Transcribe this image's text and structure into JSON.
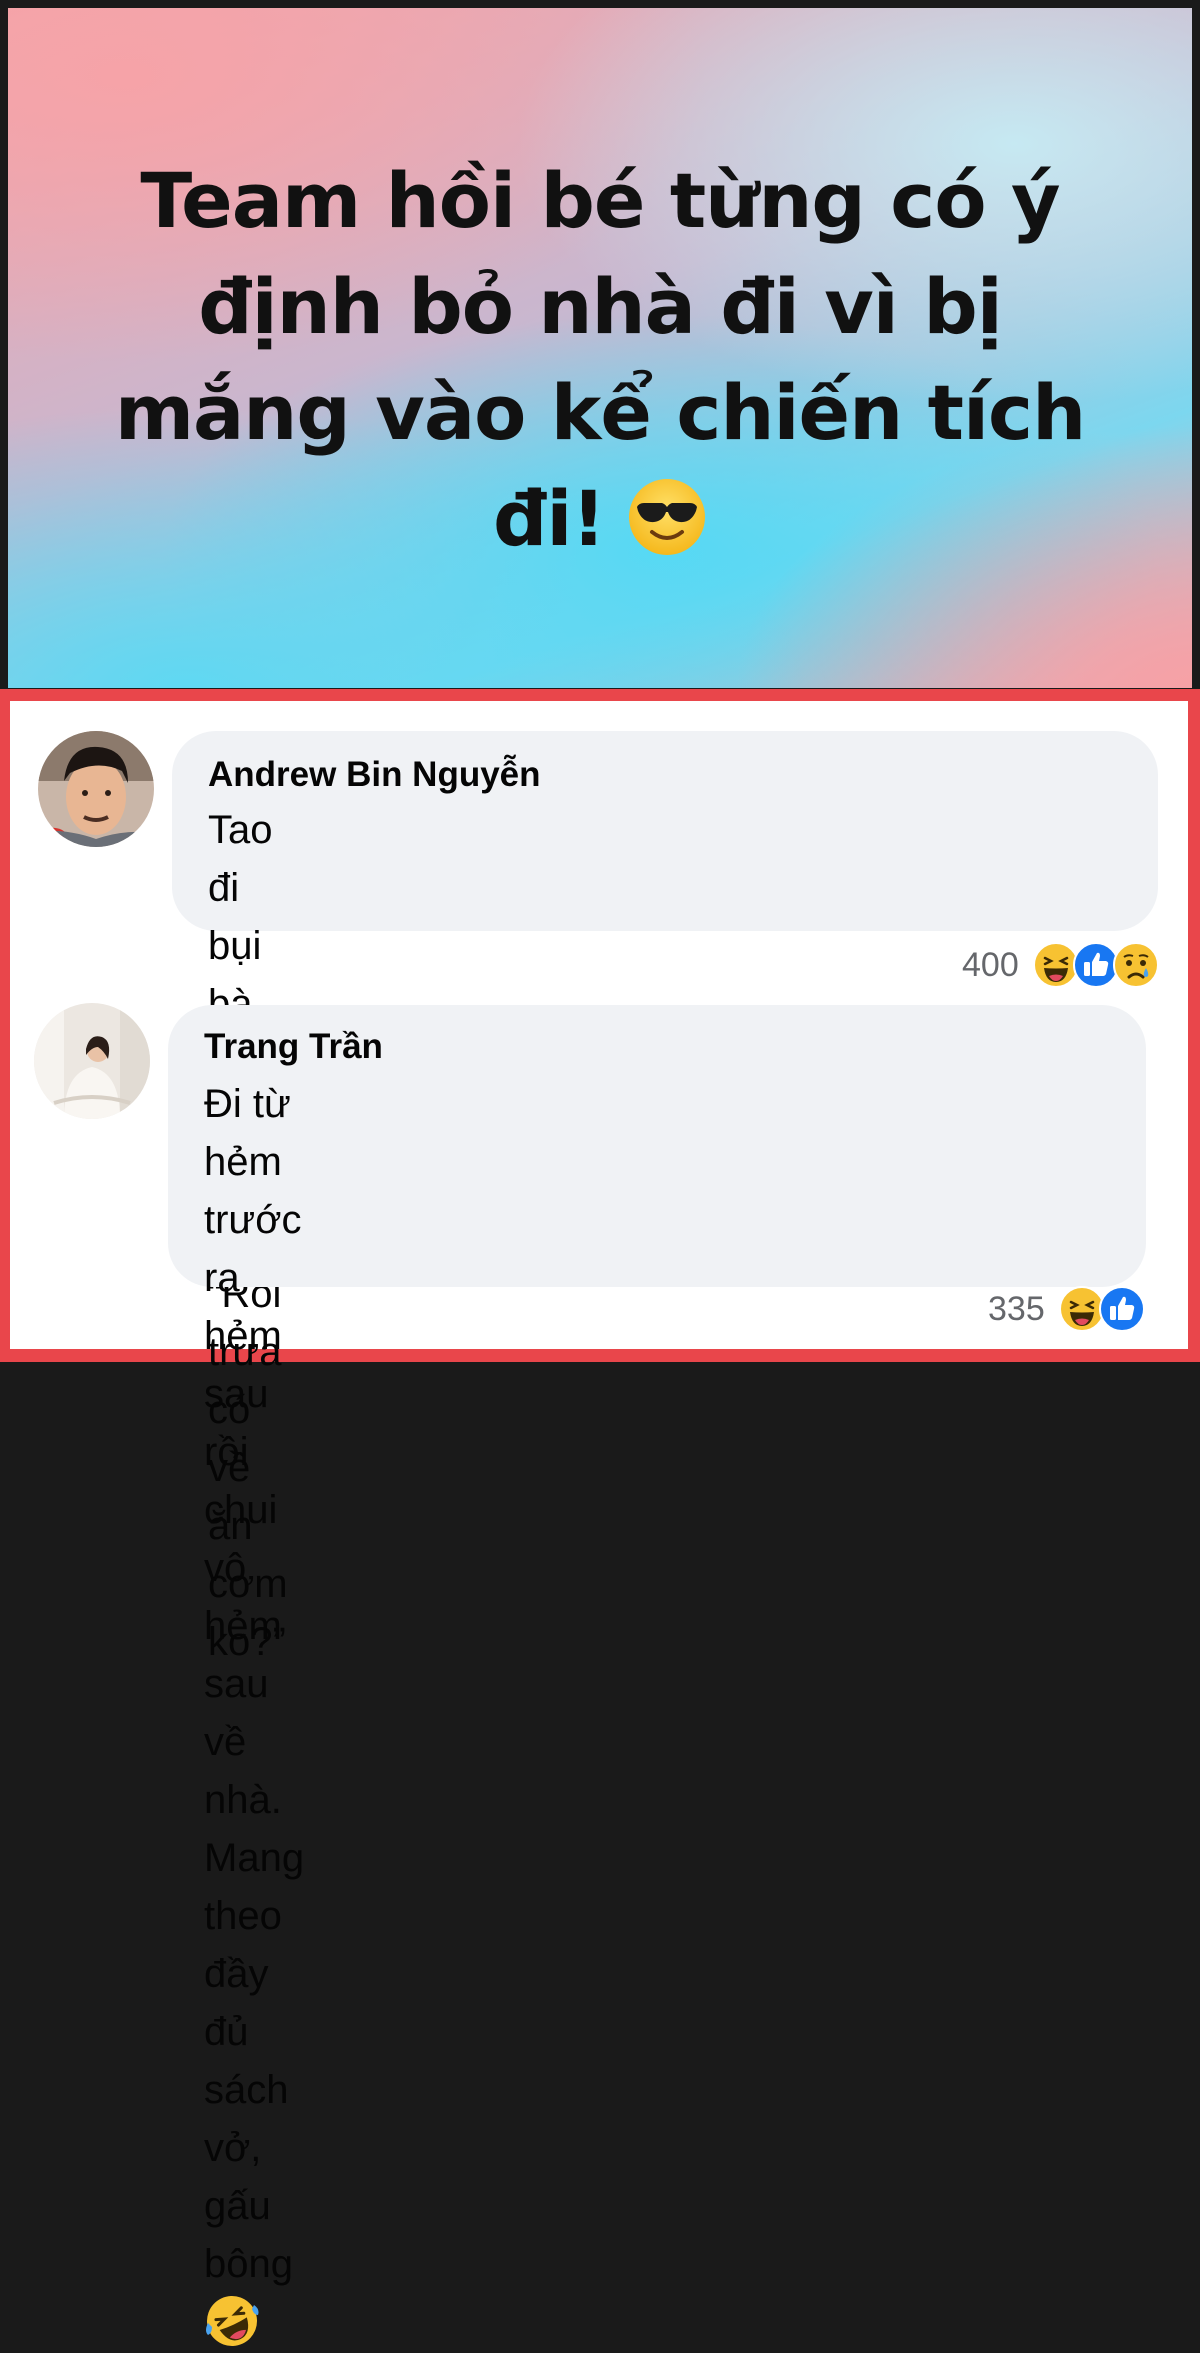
{
  "post": {
    "line1": "Team hồi bé từng có ý",
    "line2": "định bỏ nhà đi vì bị",
    "line3": "mắng vào kể chiến tích",
    "line4": "đi!",
    "emoji": "sunglasses-face-icon",
    "colors": {
      "pink": "#f3a4aa",
      "cyan": "#5fd8f2"
    }
  },
  "panel": {
    "border_color": "#e9464b"
  },
  "comments": [
    {
      "author": "Andrew Bin Nguyễn",
      "line1": "Tao đi bụi bà già hỏi với theo “Rồi trưa có về",
      "line2": "ăn cơm ko?”",
      "reaction_count": "400",
      "reactions": [
        "haha-icon",
        "like-icon",
        "sad-icon"
      ]
    },
    {
      "author": "Trang Trần",
      "line1": "Đi từ hẻm trước ra hẻm sau rồi chui vô hẻm",
      "line2": "sau về nhà. Mang theo đầy đủ sách vở, gấu",
      "line3": "bông",
      "inline_emoji": "rofl-icon",
      "reaction_count": "335",
      "reactions": [
        "haha-icon",
        "like-icon"
      ]
    }
  ]
}
